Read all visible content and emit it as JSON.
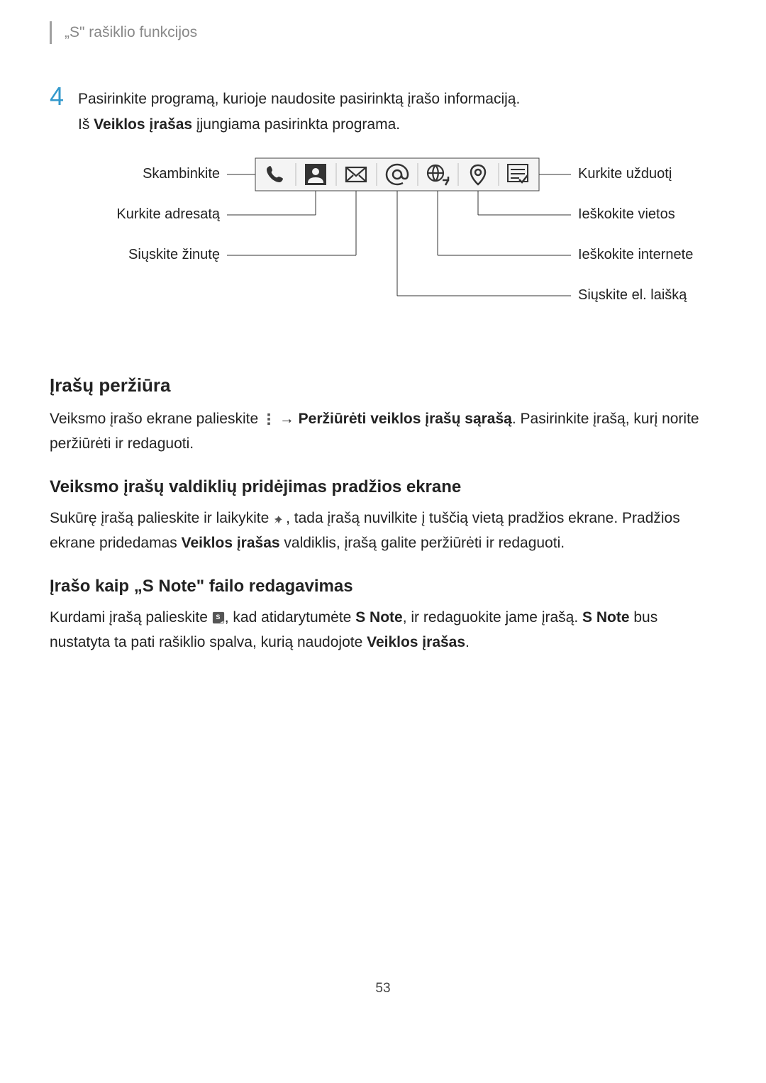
{
  "header": "„S\" rašiklio funkcijos",
  "step": {
    "number": "4",
    "text": "Pasirinkite programą, kurioje naudosite pasirinktą įrašo informaciją."
  },
  "subline": {
    "prefix": "Iš ",
    "bold": "Veiklos įrašas",
    "suffix": " įjungiama pasirinkta programa."
  },
  "diagram": {
    "left": [
      "Skambinkite",
      "Kurkite adresatą",
      "Siųskite žinutę"
    ],
    "right": [
      "Kurkite užduotį",
      "Ieškokite vietos",
      "Ieškokite internete",
      "Siųskite el. laišką"
    ],
    "icons": [
      "phone-icon",
      "person-icon",
      "envelope-icon",
      "at-icon",
      "globe-arrow-icon",
      "pin-icon",
      "checklist-icon"
    ]
  },
  "sections": {
    "review": {
      "title": "Įrašų peržiūra",
      "p1a": "Veiksmo įrašo ekrane palieskite ",
      "p1arrow": " → ",
      "p1bold": "Peržiūrėti veiklos įrašų sąrašą",
      "p1b": ". Pasirinkite įrašą, kurį norite peržiūrėti ir redaguoti."
    },
    "widgets": {
      "title": "Veiksmo įrašų valdiklių pridėjimas pradžios ekrane",
      "p1a": "Sukūrę įrašą palieskite ir laikykite ",
      "p1b": ", tada įrašą nuvilkite į tuščią vietą pradžios ekrane. Pradžios ekrane pridedamas ",
      "p1bold": "Veiklos įrašas",
      "p1c": " valdiklis, įrašą galite peržiūrėti ir redaguoti."
    },
    "snote": {
      "title": "Įrašo kaip „S Note\" failo redagavimas",
      "p1a": "Kurdami įrašą palieskite ",
      "p1b": ", kad atidarytumėte ",
      "p1bold1": "S Note",
      "p1c": ", ir redaguokite jame įrašą. ",
      "p1bold2": "S Note",
      "p1d": " bus nustatyta ta pati rašiklio spalva, kurią naudojote ",
      "p1bold3": "Veiklos įrašas",
      "p1e": "."
    }
  },
  "pagenum": "53"
}
